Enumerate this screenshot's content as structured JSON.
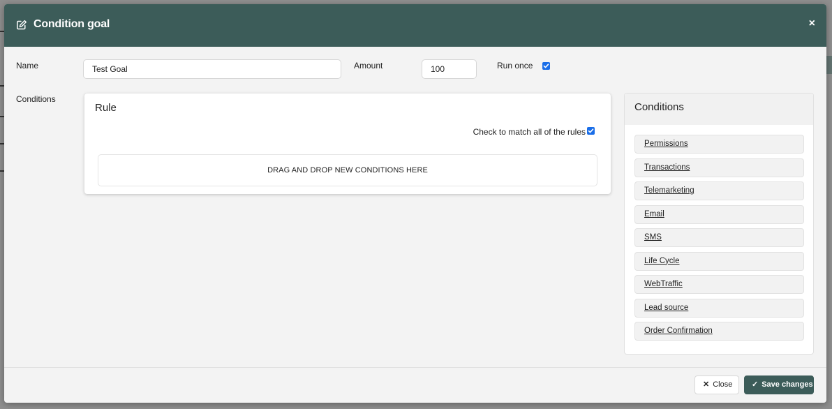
{
  "modal": {
    "title": "Condition goal",
    "edit_icon": "edit-icon",
    "close_icon": "close-icon",
    "close_glyph": "×"
  },
  "form": {
    "name_label": "Name",
    "name_value": "Test Goal",
    "amount_label": "Amount",
    "amount_value": "100",
    "run_once_label": "Run once",
    "run_once_checked": true,
    "conditions_label": "Conditions"
  },
  "rule": {
    "title": "Rule",
    "match_all_label": "Check to match all of the rules",
    "match_all_checked": true,
    "drop_zone_text": "DRAG AND DROP NEW CONDITIONS HERE"
  },
  "conditions_panel": {
    "title": "Conditions",
    "items": [
      "Permissions",
      "Transactions",
      "Telemarketing",
      "Email",
      "SMS",
      "Life Cycle",
      "WebTraffic",
      "Lead source",
      "Order Confirmation"
    ]
  },
  "footer": {
    "close_label": "Close",
    "close_icon": "close-icon",
    "close_glyph": "✕",
    "save_label": "Save changes",
    "save_icon": "check-icon",
    "save_glyph": "✓"
  },
  "colors": {
    "header_bg": "#3c5c59",
    "accent": "#3c5c59",
    "checkbox": "#1a6ee8"
  }
}
